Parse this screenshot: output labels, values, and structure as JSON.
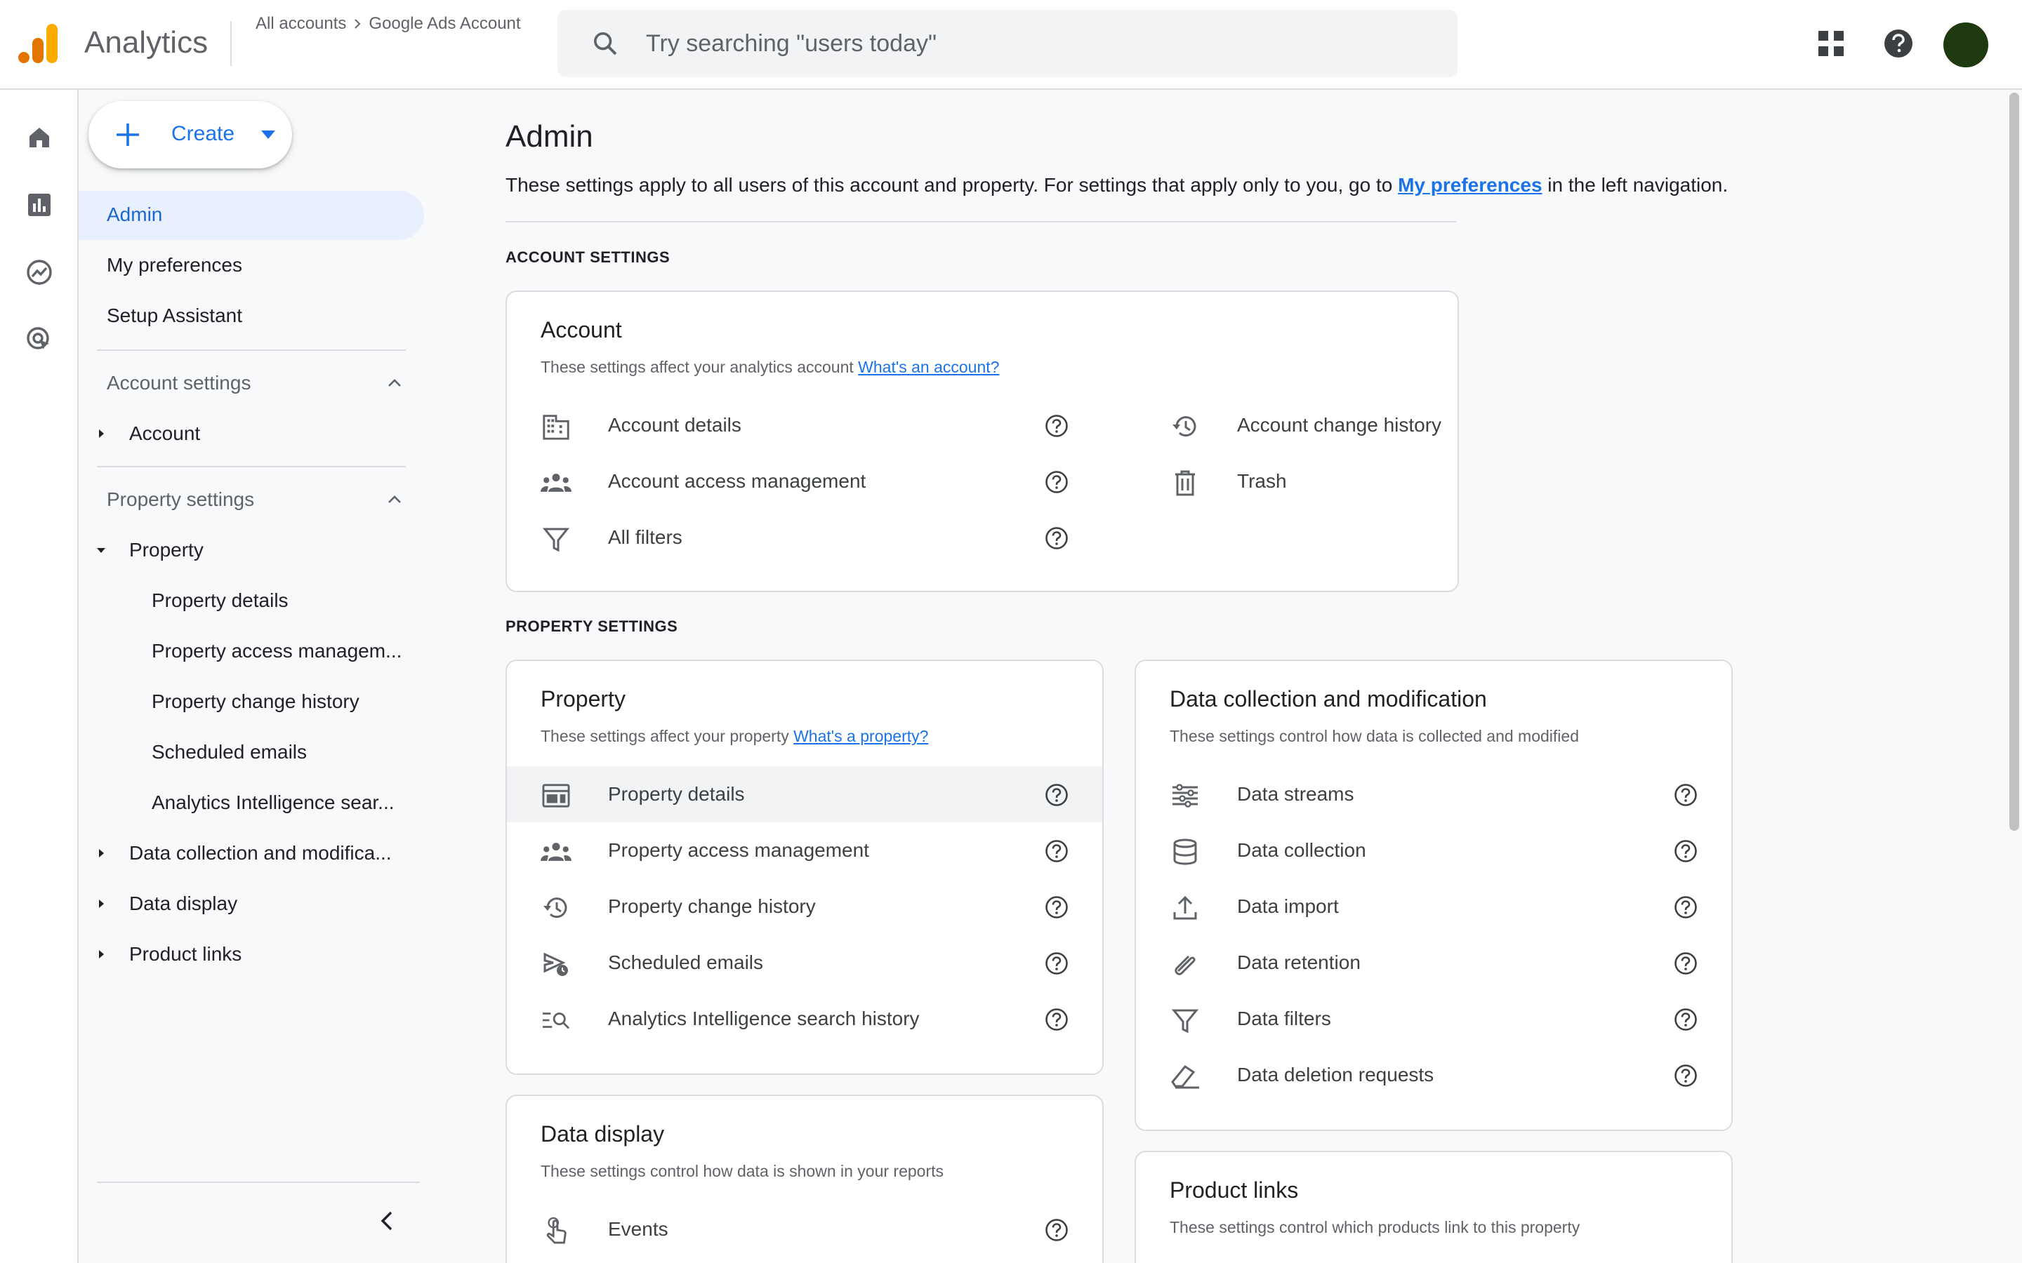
{
  "header": {
    "app_name": "Analytics",
    "breadcrumb": {
      "all_accounts": "All accounts",
      "account": "Google Ads Account"
    },
    "search_placeholder": "Try searching \"users today\"",
    "icons": [
      "apps-grid-icon",
      "help-icon",
      "account-avatar"
    ]
  },
  "rail": {
    "icons": [
      "home-icon",
      "reports-icon",
      "explore-icon",
      "advertising-icon",
      "admin-gear-icon"
    ]
  },
  "nav": {
    "create_label": "Create",
    "admin": "Admin",
    "my_preferences": "My preferences",
    "setup_assistant": "Setup Assistant",
    "account_settings": "Account settings",
    "account": "Account",
    "property_settings": "Property settings",
    "property": "Property",
    "property_children": [
      "Property details",
      "Property access managem...",
      "Property change history",
      "Scheduled emails",
      "Analytics Intelligence sear..."
    ],
    "data_collection": "Data collection and modifica...",
    "data_display": "Data display",
    "product_links": "Product links"
  },
  "main": {
    "title": "Admin",
    "desc_before": "These settings apply to all users of this account and property. For settings that apply only to you, go to ",
    "desc_link": "My preferences",
    "desc_after": " in the left navigation.",
    "account_settings_label": "ACCOUNT SETTINGS",
    "property_settings_label": "PROPERTY SETTINGS",
    "account_card": {
      "title": "Account",
      "desc": "These settings affect your analytics account ",
      "desc_link": "What's an account?",
      "left_items": [
        "Account details",
        "Account access management",
        "All filters"
      ],
      "right_items": [
        "Account change history",
        "Trash"
      ]
    },
    "property_card": {
      "title": "Property",
      "desc": "These settings affect your property ",
      "desc_link": "What's a property?",
      "items": [
        "Property details",
        "Property access management",
        "Property change history",
        "Scheduled emails",
        "Analytics Intelligence search history"
      ]
    },
    "data_collection_card": {
      "title": "Data collection and modification",
      "desc": "These settings control how data is collected and modified",
      "items": [
        "Data streams",
        "Data collection",
        "Data import",
        "Data retention",
        "Data filters",
        "Data deletion requests"
      ]
    },
    "data_display_card": {
      "title": "Data display",
      "desc": "These settings control how data is shown in your reports",
      "items": [
        "Events"
      ]
    },
    "product_links_card": {
      "title": "Product links",
      "desc": "These settings control which products link to this property"
    }
  },
  "colors": {
    "accent": "#1a73e8",
    "active_bg": "#e8f0fe",
    "avatar": "#1f3a12",
    "logo_orange": "#f9ab00",
    "logo_dark": "#e37400"
  }
}
